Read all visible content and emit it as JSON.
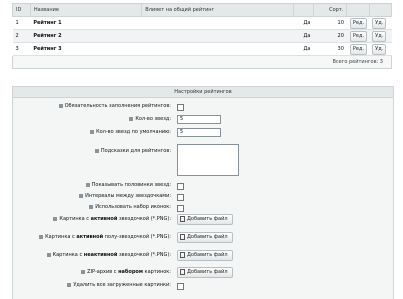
{
  "table": {
    "headers": {
      "id": "ID",
      "name": "Название",
      "influence": "Влияет на общий рейтинг",
      "sort": "Сорт."
    },
    "rows": [
      {
        "id": "1",
        "name": "Рейтинг 1",
        "yes": "Да",
        "sort": "10",
        "edit": "Ред.",
        "del": "Уд."
      },
      {
        "id": "2",
        "name": "Рейтинг 2",
        "yes": "Да",
        "sort": "20",
        "edit": "Ред.",
        "del": "Уд."
      },
      {
        "id": "3",
        "name": "Рейтинг 3",
        "yes": "Да",
        "sort": "30",
        "edit": "Ред.",
        "del": "Уд."
      }
    ],
    "footer": "Всего рейтингов: 3"
  },
  "settings": {
    "title": "Настройки рейтингов",
    "required_label": "Обязательность заполнения рейтингов:",
    "stars_label": "Кол-во звезд:",
    "stars_value": "5",
    "default_stars_label": "Кол-во звезд по умолчанию:",
    "default_stars_value": "5",
    "hints_label": "Подсказки для рейтингов:",
    "half_stars_label": "Показывать половинки звезд:",
    "interval_label": "Интервалы между звездочками:",
    "icon_set_label": "Использовать набор иконок:",
    "img_active_pre": "Картинка с ",
    "img_active_bold": "активной",
    "img_active_post": " звездочкой (*.PNG):",
    "img_half_pre": "Картинка с ",
    "img_half_bold": "активной",
    "img_half_post": " полу-звездочкой (*.PNG):",
    "img_inactive_pre": "Картинка с ",
    "img_inactive_bold": "неактивной",
    "img_inactive_post": " звездочкой (*.PNG):",
    "zip_pre": "ZIP-архив с ",
    "zip_bold": "набором",
    "zip_post": " картинок:",
    "delete_label": "Удалить все загруженные картинки:",
    "upload_label": "Добавить файл"
  }
}
